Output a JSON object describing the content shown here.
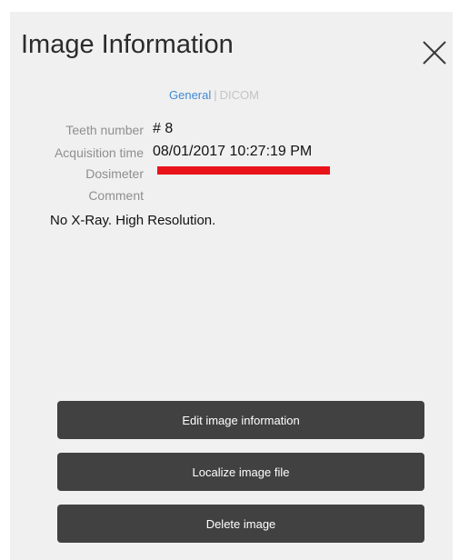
{
  "dialog": {
    "title": "Image Information"
  },
  "tabs": {
    "general": "General",
    "separator": "|",
    "dicom": "DICOM"
  },
  "fields": {
    "teeth_label": "Teeth number",
    "teeth_value": "# 8",
    "acquisition_label": "Acquisition time",
    "acquisition_value": "08/01/2017 10:27:19 PM",
    "dosimeter_label": "Dosimeter",
    "comment_label": "Comment",
    "comment_value": "No X-Ray. High Resolution."
  },
  "buttons": {
    "edit": "Edit image information",
    "localize": "Localize image file",
    "delete": "Delete image"
  },
  "colors": {
    "panel_bg": "#f0f0f0",
    "button_bg": "#414141",
    "active_tab": "#3f8ad6",
    "redaction": "#e8141a"
  },
  "icons": {
    "close": "close-icon"
  }
}
